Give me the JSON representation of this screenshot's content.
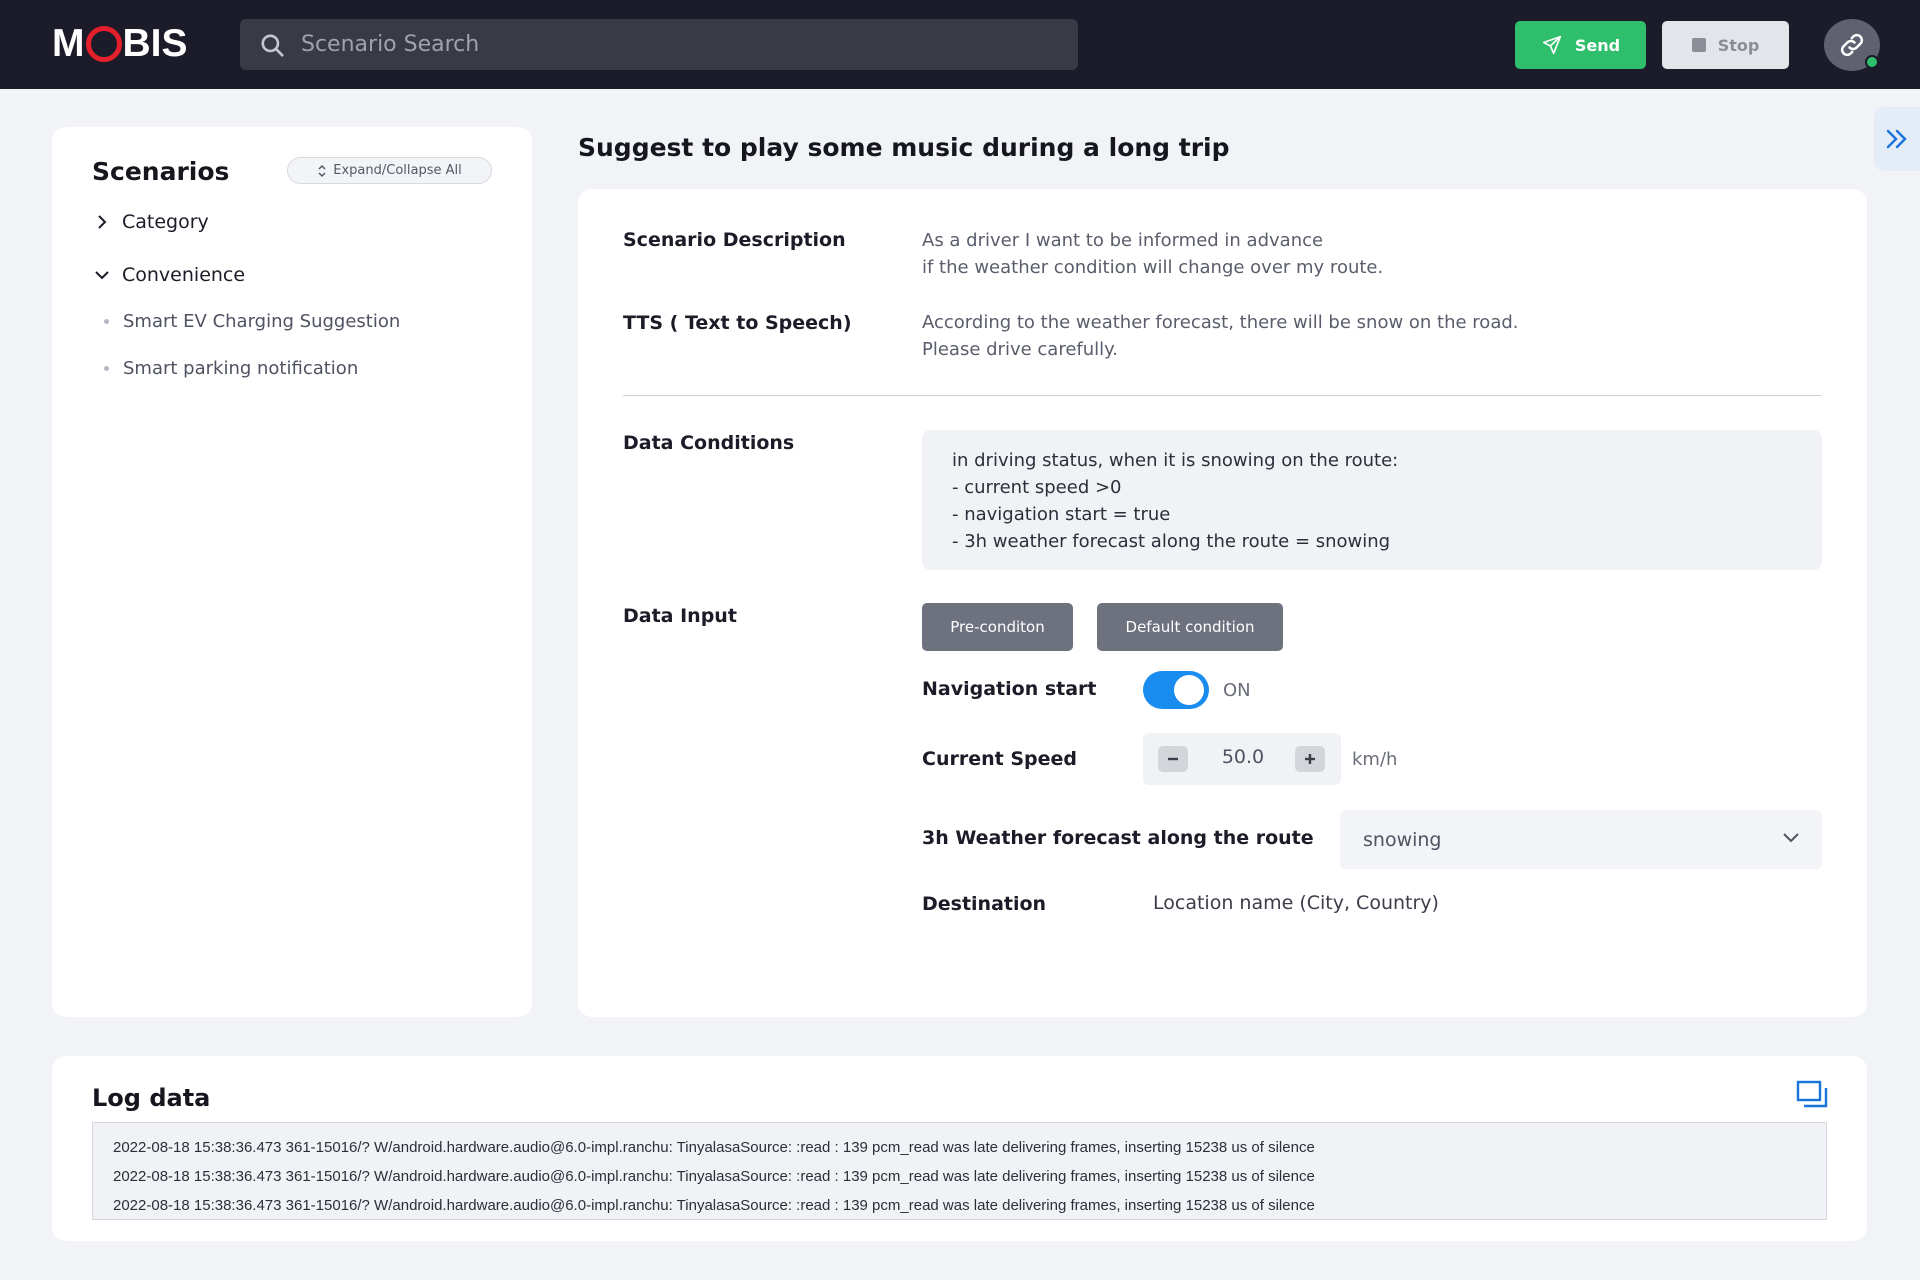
{
  "header": {
    "logo_prefix": "M",
    "logo_suffix": "BIS",
    "search_placeholder": "Scenario Search",
    "send_label": "Send",
    "stop_label": "Stop",
    "status_color": "#2fbf6c"
  },
  "sidebar": {
    "title": "Scenarios",
    "expand_collapse_label": "Expand/Collapse All",
    "groups": [
      {
        "label": "Category",
        "expanded": false
      },
      {
        "label": "Convenience",
        "expanded": true,
        "items": [
          "Smart EV Charging Suggestion",
          "Smart parking notification"
        ]
      }
    ]
  },
  "main": {
    "title": "Suggest to play some music during a long trip",
    "scenario_description_label": "Scenario Description",
    "scenario_description_lines": [
      "As a driver I want to be informed in advance",
      "if the weather condition will change over my route."
    ],
    "tts_label": "TTS ( Text to Speech)",
    "tts_lines": [
      "According to the weather forecast, there will be snow on the road.",
      "Please drive carefully."
    ],
    "data_conditions_label": "Data Conditions",
    "data_conditions_lines": [
      "in driving status, when it is snowing on the route:",
      "- current speed >0",
      "- navigation start = true",
      "- 3h weather forecast along the route = snowing"
    ],
    "data_input_label": "Data Input",
    "precondition_button": "Pre-conditon",
    "default_condition_button": "Default condition",
    "navigation_start_label": "Navigation start",
    "navigation_start_state": "ON",
    "current_speed_label": "Current Speed",
    "current_speed_value": "50.0",
    "current_speed_unit": "km/h",
    "weather_label": "3h Weather forecast along the route",
    "weather_value": "snowing",
    "destination_label": "Destination",
    "destination_value": "Location name (City, Country)"
  },
  "log": {
    "title": "Log data",
    "lines": [
      "2022-08-18 15:38:36.473 361-15016/?  W/android.hardware.audio@6.0-impl.ranchu:  TinyalasaSource: :read : 139  pcm_read  was  late  delivering  frames, inserting 15238 us of silence",
      "2022-08-18 15:38:36.473 361-15016/?  W/android.hardware.audio@6.0-impl.ranchu:  TinyalasaSource: :read : 139  pcm_read  was  late  delivering  frames, inserting 15238 us of silence",
      "2022-08-18 15:38:36.473 361-15016/?  W/android.hardware.audio@6.0-impl.ranchu:  TinyalasaSource: :read : 139  pcm_read  was  late  delivering  frames, inserting 15238 us of silence"
    ]
  }
}
